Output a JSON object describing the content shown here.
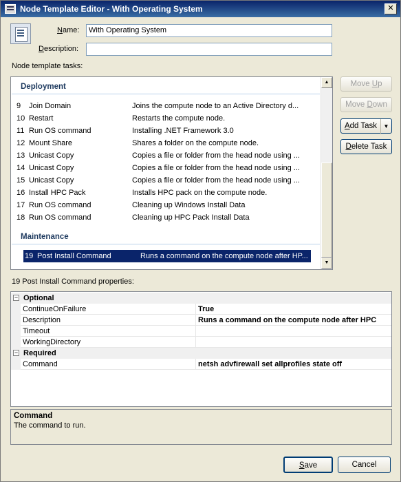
{
  "window": {
    "title": "Node Template Editor - With Operating System",
    "close_glyph": "✕"
  },
  "form": {
    "name_label_u": "N",
    "name_label_rest": "ame:",
    "name_value": "With Operating System",
    "description_label_u": "D",
    "description_label_rest": "escription:",
    "description_value": ""
  },
  "tasks_label": "Node template tasks:",
  "groups": {
    "deployment": "Deployment",
    "maintenance": "Maintenance"
  },
  "tasks": [
    {
      "num": "9",
      "name": "Join Domain",
      "desc": "Joins the compute node to an Active Directory d..."
    },
    {
      "num": "10",
      "name": "Restart",
      "desc": "Restarts the compute node."
    },
    {
      "num": "11",
      "name": "Run OS command",
      "desc": "Installing .NET Framework 3.0"
    },
    {
      "num": "12",
      "name": "Mount Share",
      "desc": "Shares a folder on the compute node."
    },
    {
      "num": "13",
      "name": "Unicast Copy",
      "desc": "Copies a file or folder from the head node using ..."
    },
    {
      "num": "14",
      "name": "Unicast Copy",
      "desc": "Copies a file or folder from the head node using ..."
    },
    {
      "num": "15",
      "name": "Unicast Copy",
      "desc": "Copies a file or folder from the head node using ..."
    },
    {
      "num": "16",
      "name": "Install HPC Pack",
      "desc": "Installs HPC pack on the compute node."
    },
    {
      "num": "17",
      "name": "Run OS command",
      "desc": "Cleaning up Windows Install Data"
    },
    {
      "num": "18",
      "name": "Run OS command",
      "desc": "Cleaning up HPC Pack Install Data"
    }
  ],
  "selected_task": {
    "num": "19",
    "name": "Post Install Command",
    "desc": "Runs a command on the compute node after HP..."
  },
  "buttons": {
    "move_up_u": "Move ",
    "move_up_k": "U",
    "move_up_rest": "p",
    "move_down_u": "Move ",
    "move_down_k": "D",
    "move_down_rest": "own",
    "add_task_k": "A",
    "add_task_rest": "dd Task",
    "delete_task_k": "D",
    "delete_task_rest": "elete Task",
    "save_k": "S",
    "save_rest": "ave",
    "cancel": "Cancel"
  },
  "properties_label": "19 Post Install Command properties:",
  "prop_grid": {
    "optional": "Optional",
    "required": "Required",
    "collapse_glyph": "−",
    "rows": [
      {
        "name": "ContinueOnFailure",
        "value": "True"
      },
      {
        "name": "Description",
        "value": "Runs a command on the compute node after HPC"
      },
      {
        "name": "Timeout",
        "value": ""
      },
      {
        "name": "WorkingDirectory",
        "value": ""
      }
    ],
    "required_rows": [
      {
        "name": "Command",
        "value": "netsh advfirewall set allprofiles state off"
      }
    ]
  },
  "help": {
    "title": "Command",
    "text": "The command to run."
  }
}
